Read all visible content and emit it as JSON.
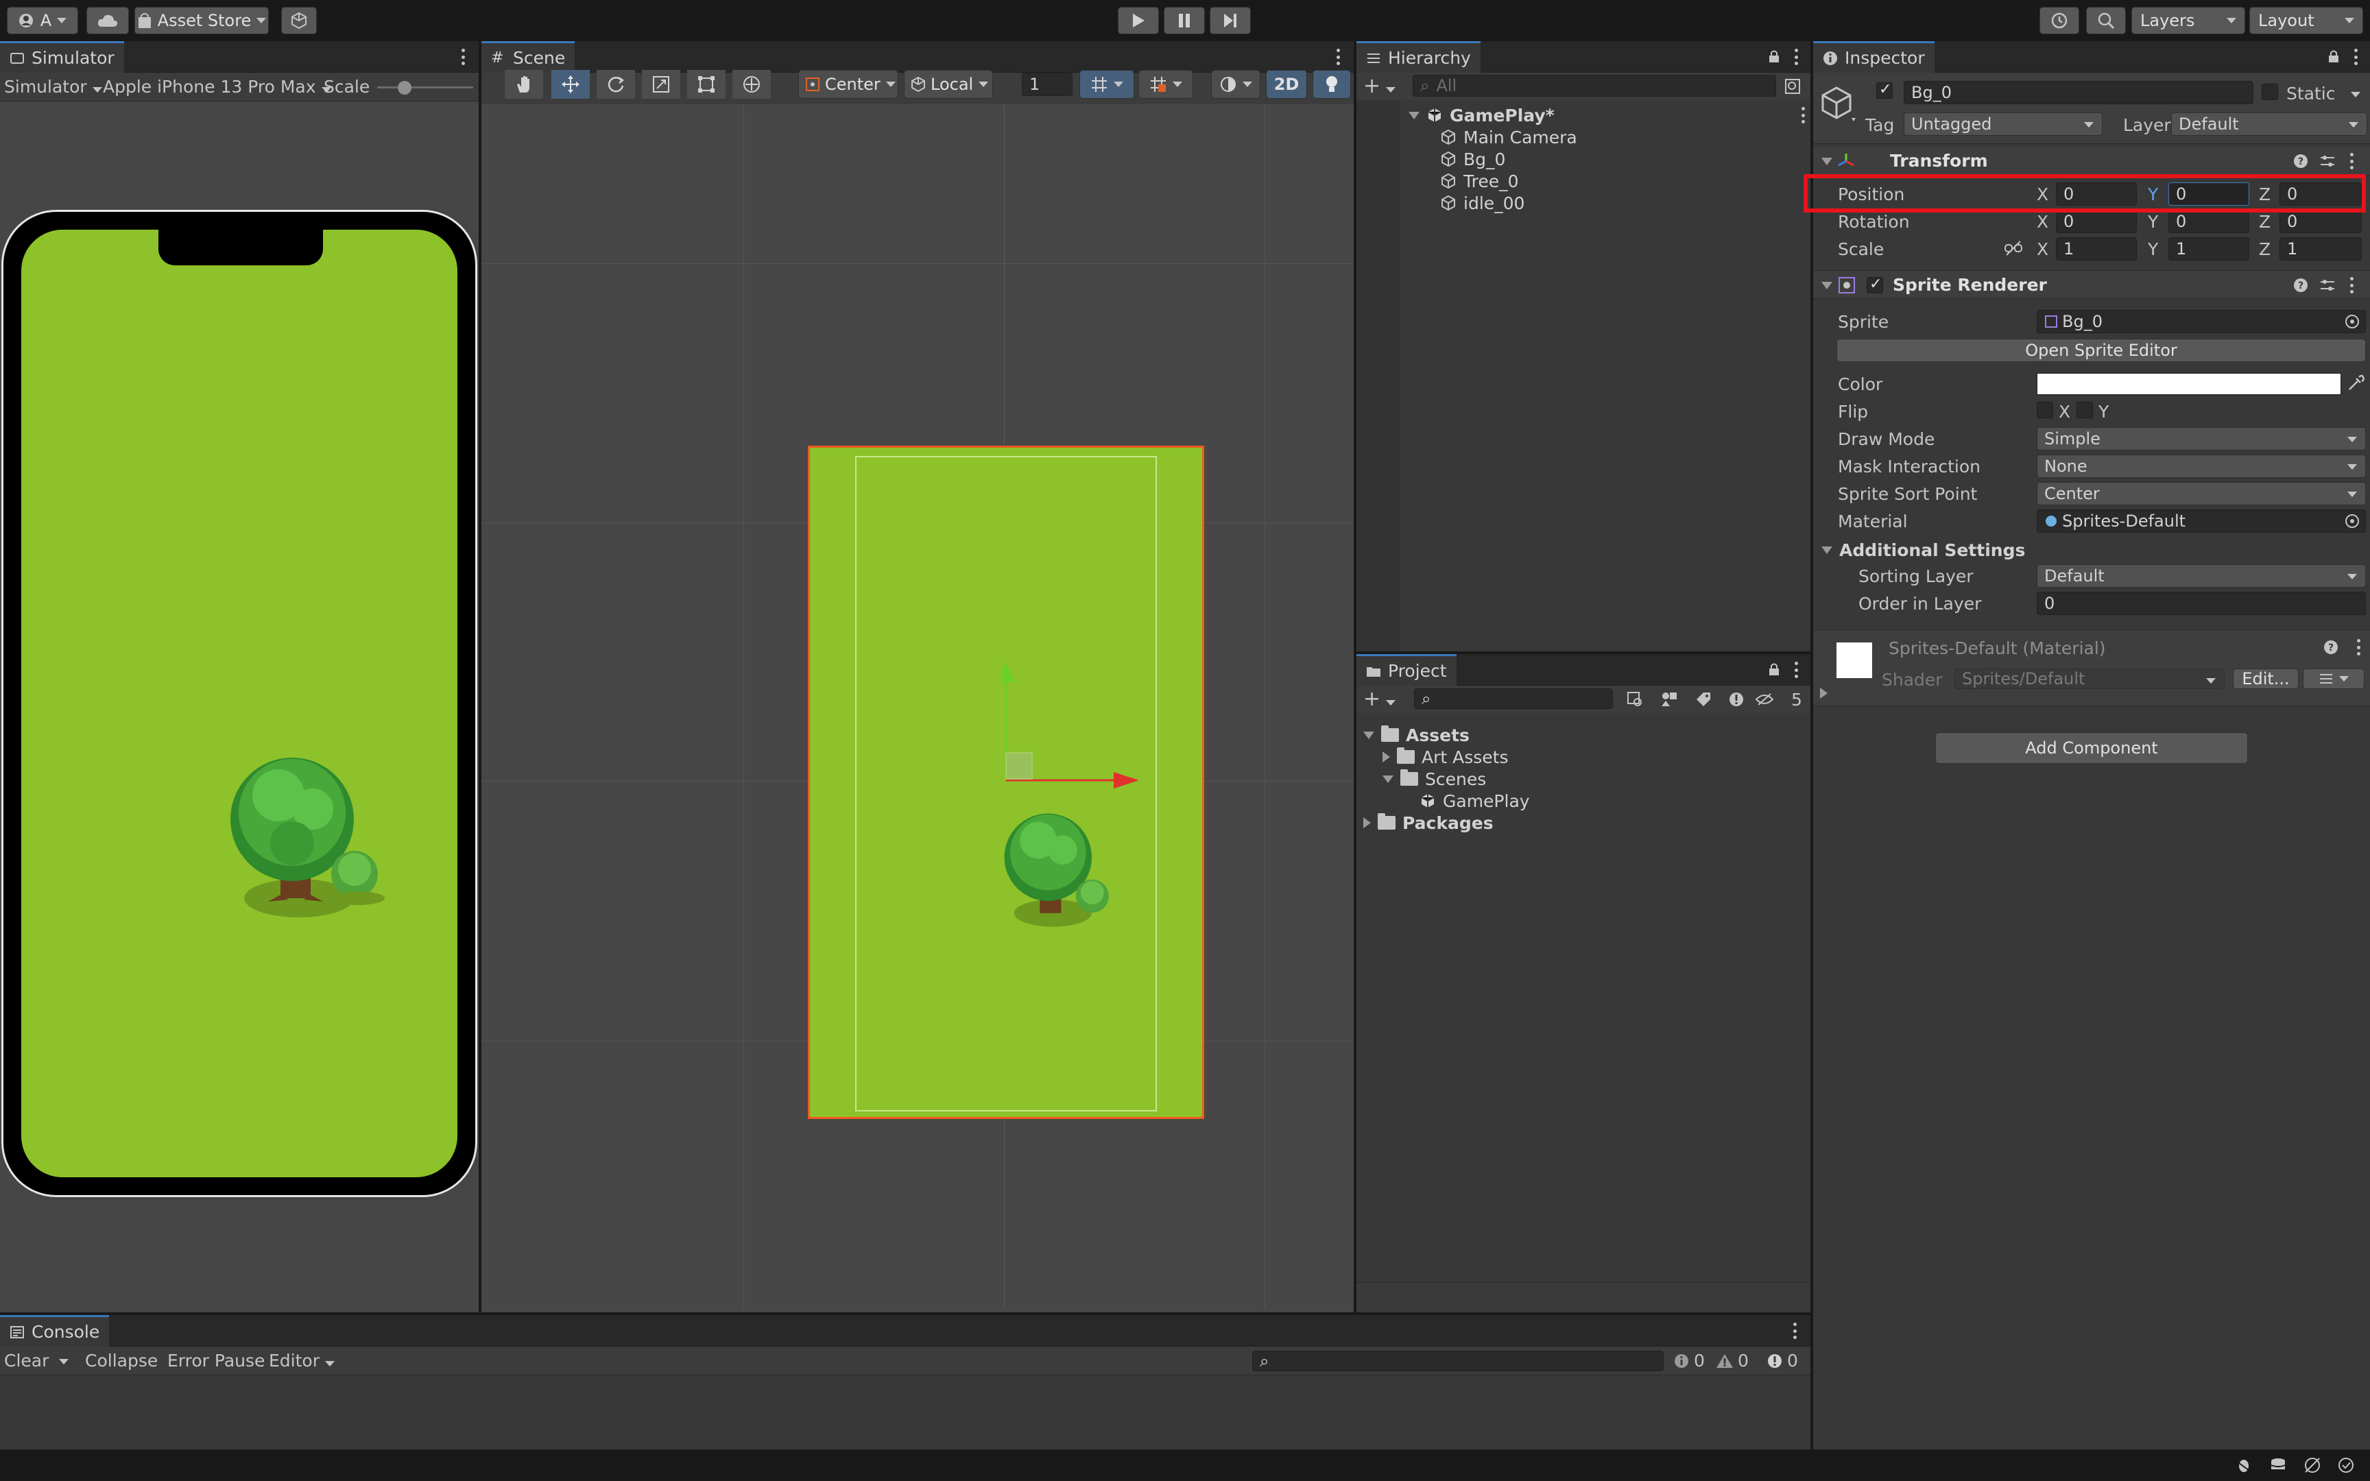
{
  "toolbar": {
    "account_label": "A",
    "asset_store_label": "Asset Store",
    "layers_label": "Layers",
    "layout_label": "Layout"
  },
  "simulator": {
    "tab_label": "Simulator",
    "mode_label": "Simulator",
    "device_label": "Apple iPhone 13 Pro Max",
    "scale_label": "Scale",
    "screen_color": "#8dc22a"
  },
  "scene": {
    "tab_label": "Scene",
    "pivot_label": "Center",
    "space_label": "Local",
    "snap_value": "1",
    "mode_2d_label": "2D",
    "sprite_color": "#8dc22a",
    "selection_color": "#f05a1e"
  },
  "hierarchy": {
    "tab_label": "Hierarchy",
    "search_placeholder": "All",
    "root_label": "GamePlay*",
    "items": [
      "Main Camera",
      "Bg_0",
      "Tree_0",
      "idle_00"
    ]
  },
  "project": {
    "tab_label": "Project",
    "hidden_count": "5",
    "assets_label": "Assets",
    "art_assets_label": "Art Assets",
    "scenes_label": "Scenes",
    "gameplay_label": "GamePlay",
    "packages_label": "Packages"
  },
  "inspector": {
    "tab_label": "Inspector",
    "object_name": "Bg_0",
    "static_label": "Static",
    "tag_label": "Tag",
    "tag_value": "Untagged",
    "layer_label": "Layer",
    "layer_value": "Default",
    "transform": {
      "title": "Transform",
      "position_label": "Position",
      "rotation_label": "Rotation",
      "scale_label": "Scale",
      "x_label": "X",
      "y_label": "Y",
      "z_label": "Z",
      "position": [
        "0",
        "0",
        "0"
      ],
      "rotation": [
        "0",
        "0",
        "0"
      ],
      "scale": [
        "1",
        "1",
        "1"
      ]
    },
    "sprite_renderer": {
      "title": "Sprite Renderer",
      "sprite_label": "Sprite",
      "sprite_value": "Bg_0",
      "open_editor_label": "Open Sprite Editor",
      "color_label": "Color",
      "flip_label": "Flip",
      "flip_x": "X",
      "flip_y": "Y",
      "draw_mode_label": "Draw Mode",
      "draw_mode_value": "Simple",
      "mask_label": "Mask Interaction",
      "mask_value": "None",
      "sort_point_label": "Sprite Sort Point",
      "sort_point_value": "Center",
      "material_label": "Material",
      "material_value": "Sprites-Default",
      "additional_label": "Additional Settings",
      "sorting_layer_label": "Sorting Layer",
      "sorting_layer_value": "Default",
      "order_label": "Order in Layer",
      "order_value": "0"
    },
    "material": {
      "title": "Sprites-Default (Material)",
      "shader_label": "Shader",
      "shader_value": "Sprites/Default",
      "edit_label": "Edit..."
    },
    "add_component_label": "Add Component",
    "highlight_color": "#e8141c"
  },
  "console": {
    "tab_label": "Console",
    "clear_label": "Clear",
    "collapse_label": "Collapse",
    "error_pause_label": "Error Pause",
    "editor_label": "Editor",
    "log_count": "0",
    "warning_count": "0",
    "error_count": "0"
  }
}
